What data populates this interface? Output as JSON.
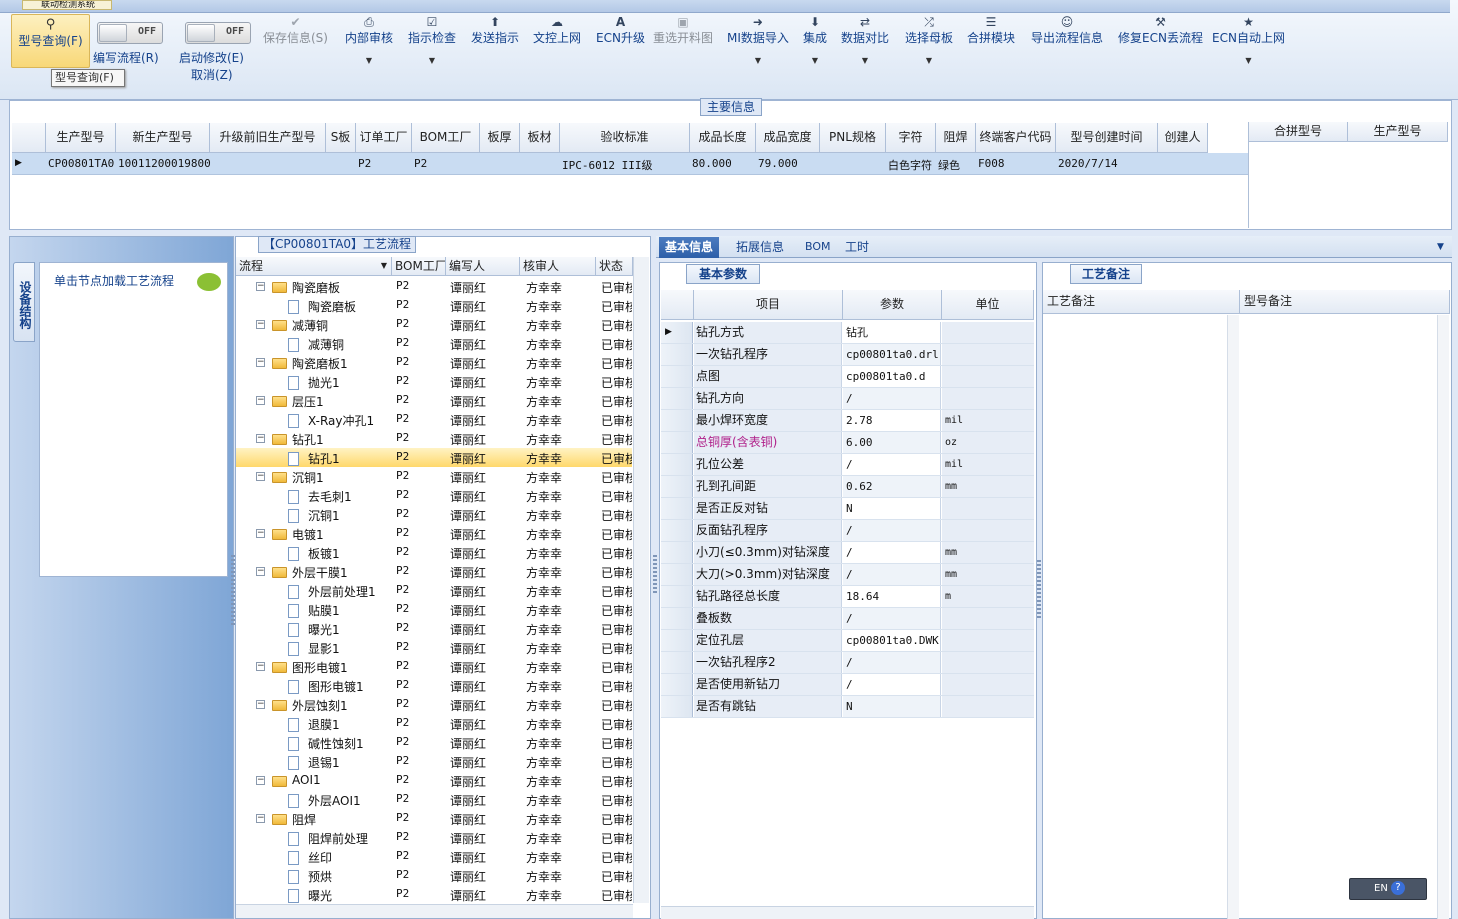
{
  "app": {
    "tab_title": "联动检测系统"
  },
  "toolbar": {
    "query": {
      "label": "型号查询(F)"
    },
    "toggle1": {
      "state": "OFF",
      "label": "编写流程(R)"
    },
    "toggle2": {
      "state": "OFF",
      "label": "启动修改(E)",
      "sublabel": "取消(Z)"
    },
    "buttons": [
      {
        "label": "保存信息(S)",
        "icon": "check-icon"
      },
      {
        "label": "内部审核",
        "icon": "printer-icon"
      },
      {
        "label": "指示检查",
        "icon": "checkbox-icon"
      },
      {
        "label": "发送指示",
        "icon": "upload-icon"
      },
      {
        "label": "文控上网",
        "icon": "cloud-upload-icon"
      },
      {
        "label": "ECN升级",
        "icon": "font-icon"
      },
      {
        "label": "重选开料图",
        "icon": "image-icon"
      },
      {
        "label": "MI数据导入",
        "icon": "import-icon"
      },
      {
        "label": "集成",
        "icon": "download-icon"
      },
      {
        "label": "数据对比",
        "icon": "compare-icon"
      },
      {
        "label": "选择母板",
        "icon": "shuffle-icon"
      },
      {
        "label": "合拼模块",
        "icon": "list-icon"
      },
      {
        "label": "导出流程信息",
        "icon": "smile-icon"
      },
      {
        "label": "修复ECN丢流程",
        "icon": "wrench-icon"
      },
      {
        "label": "ECN自动上网",
        "icon": "star-icon"
      }
    ],
    "tooltip": "型号查询(F)"
  },
  "main_info": {
    "title": "主要信息",
    "columns": [
      "生产型号",
      "新生产型号",
      "升级前旧生产型号",
      "S板",
      "订单工厂",
      "BOM工厂",
      "板厚",
      "板材",
      "验收标准",
      "成品长度",
      "成品宽度",
      "PNL规格",
      "字符",
      "阻焊",
      "终端客户代码",
      "型号创建时间",
      "创建人"
    ],
    "row": {
      "生产型号": "CP00801TA0",
      "新生产型号": "10011200019800",
      "订单工厂": "P2",
      "BOM工厂": "P2",
      "验收标准": "IPC-6012 III级",
      "成品长度": "80.000",
      "成品宽度": "79.000",
      "字符": "白色字符",
      "阻焊": "绿色",
      "终端客户代码": "F008",
      "型号创建时间": "2020/7/14"
    },
    "side_columns": [
      "合拼型号",
      "生产型号"
    ]
  },
  "left_panel": {
    "vtab": "设备结构",
    "hint": "单击节点加载工艺流程"
  },
  "tree": {
    "title": "【CP00801TA0】工艺流程",
    "columns": [
      "流程",
      "BOM工厂",
      "编写人",
      "核审人",
      "状态"
    ],
    "rows": [
      {
        "name": "陶瓷磨板",
        "level": 1,
        "folder": true,
        "bom": "P2",
        "writer": "谭丽红",
        "reviewer": "方幸幸",
        "status": "已审核"
      },
      {
        "name": "陶瓷磨板",
        "level": 2,
        "folder": false,
        "bom": "P2",
        "writer": "谭丽红",
        "reviewer": "方幸幸",
        "status": "已审核"
      },
      {
        "name": "减薄铜",
        "level": 1,
        "folder": true,
        "bom": "P2",
        "writer": "谭丽红",
        "reviewer": "方幸幸",
        "status": "已审核"
      },
      {
        "name": "减薄铜",
        "level": 2,
        "folder": false,
        "bom": "P2",
        "writer": "谭丽红",
        "reviewer": "方幸幸",
        "status": "已审核"
      },
      {
        "name": "陶瓷磨板1",
        "level": 1,
        "folder": true,
        "bom": "P2",
        "writer": "谭丽红",
        "reviewer": "方幸幸",
        "status": "已审核"
      },
      {
        "name": "抛光1",
        "level": 2,
        "folder": false,
        "bom": "P2",
        "writer": "谭丽红",
        "reviewer": "方幸幸",
        "status": "已审核"
      },
      {
        "name": "层压1",
        "level": 1,
        "folder": true,
        "bom": "P2",
        "writer": "谭丽红",
        "reviewer": "方幸幸",
        "status": "已审核"
      },
      {
        "name": "X-Ray冲孔1",
        "level": 2,
        "folder": false,
        "bom": "P2",
        "writer": "谭丽红",
        "reviewer": "方幸幸",
        "status": "已审核"
      },
      {
        "name": "钻孔1",
        "level": 1,
        "folder": true,
        "bom": "P2",
        "writer": "谭丽红",
        "reviewer": "方幸幸",
        "status": "已审核"
      },
      {
        "name": "钻孔1",
        "level": 2,
        "folder": false,
        "bom": "P2",
        "writer": "谭丽红",
        "reviewer": "方幸幸",
        "status": "已审核",
        "selected": true
      },
      {
        "name": "沉铜1",
        "level": 1,
        "folder": true,
        "bom": "P2",
        "writer": "谭丽红",
        "reviewer": "方幸幸",
        "status": "已审核"
      },
      {
        "name": "去毛刺1",
        "level": 2,
        "folder": false,
        "bom": "P2",
        "writer": "谭丽红",
        "reviewer": "方幸幸",
        "status": "已审核"
      },
      {
        "name": "沉铜1",
        "level": 2,
        "folder": false,
        "bom": "P2",
        "writer": "谭丽红",
        "reviewer": "方幸幸",
        "status": "已审核"
      },
      {
        "name": "电镀1",
        "level": 1,
        "folder": true,
        "bom": "P2",
        "writer": "谭丽红",
        "reviewer": "方幸幸",
        "status": "已审核"
      },
      {
        "name": "板镀1",
        "level": 2,
        "folder": false,
        "bom": "P2",
        "writer": "谭丽红",
        "reviewer": "方幸幸",
        "status": "已审核"
      },
      {
        "name": "外层干膜1",
        "level": 1,
        "folder": true,
        "bom": "P2",
        "writer": "谭丽红",
        "reviewer": "方幸幸",
        "status": "已审核"
      },
      {
        "name": "外层前处理1",
        "level": 2,
        "folder": false,
        "bom": "P2",
        "writer": "谭丽红",
        "reviewer": "方幸幸",
        "status": "已审核"
      },
      {
        "name": "贴膜1",
        "level": 2,
        "folder": false,
        "bom": "P2",
        "writer": "谭丽红",
        "reviewer": "方幸幸",
        "status": "已审核"
      },
      {
        "name": "曝光1",
        "level": 2,
        "folder": false,
        "bom": "P2",
        "writer": "谭丽红",
        "reviewer": "方幸幸",
        "status": "已审核"
      },
      {
        "name": "显影1",
        "level": 2,
        "folder": false,
        "bom": "P2",
        "writer": "谭丽红",
        "reviewer": "方幸幸",
        "status": "已审核"
      },
      {
        "name": "图形电镀1",
        "level": 1,
        "folder": true,
        "bom": "P2",
        "writer": "谭丽红",
        "reviewer": "方幸幸",
        "status": "已审核"
      },
      {
        "name": "图形电镀1",
        "level": 2,
        "folder": false,
        "bom": "P2",
        "writer": "谭丽红",
        "reviewer": "方幸幸",
        "status": "已审核"
      },
      {
        "name": "外层蚀刻1",
        "level": 1,
        "folder": true,
        "bom": "P2",
        "writer": "谭丽红",
        "reviewer": "方幸幸",
        "status": "已审核"
      },
      {
        "name": "退膜1",
        "level": 2,
        "folder": false,
        "bom": "P2",
        "writer": "谭丽红",
        "reviewer": "方幸幸",
        "status": "已审核"
      },
      {
        "name": "碱性蚀刻1",
        "level": 2,
        "folder": false,
        "bom": "P2",
        "writer": "谭丽红",
        "reviewer": "方幸幸",
        "status": "已审核"
      },
      {
        "name": "退锡1",
        "level": 2,
        "folder": false,
        "bom": "P2",
        "writer": "谭丽红",
        "reviewer": "方幸幸",
        "status": "已审核"
      },
      {
        "name": "AOI1",
        "level": 1,
        "folder": true,
        "bom": "P2",
        "writer": "谭丽红",
        "reviewer": "方幸幸",
        "status": "已审核"
      },
      {
        "name": "外层AOI1",
        "level": 2,
        "folder": false,
        "bom": "P2",
        "writer": "谭丽红",
        "reviewer": "方幸幸",
        "status": "已审核"
      },
      {
        "name": "阻焊",
        "level": 1,
        "folder": true,
        "bom": "P2",
        "writer": "谭丽红",
        "reviewer": "方幸幸",
        "status": "已审核"
      },
      {
        "name": "阻焊前处理",
        "level": 2,
        "folder": false,
        "bom": "P2",
        "writer": "谭丽红",
        "reviewer": "方幸幸",
        "status": "已审核"
      },
      {
        "name": "丝印",
        "level": 2,
        "folder": false,
        "bom": "P2",
        "writer": "谭丽红",
        "reviewer": "方幸幸",
        "status": "已审核"
      },
      {
        "name": "预烘",
        "level": 2,
        "folder": false,
        "bom": "P2",
        "writer": "谭丽红",
        "reviewer": "方幸幸",
        "status": "已审核"
      },
      {
        "name": "曝光",
        "level": 2,
        "folder": false,
        "bom": "P2",
        "writer": "谭丽红",
        "reviewer": "方幸幸",
        "status": "已审核"
      }
    ]
  },
  "right_tabs": [
    "基本信息",
    "拓展信息",
    "BOM",
    "工时"
  ],
  "basic": {
    "title": "基本参数",
    "columns": [
      "项目",
      "参数",
      "单位"
    ],
    "rows": [
      {
        "item": "钻孔方式",
        "value": "钻孔",
        "unit": ""
      },
      {
        "item": "一次钻孔程序",
        "value": "cp00801ta0.drl",
        "unit": ""
      },
      {
        "item": "点图",
        "value": "cp00801ta0.d",
        "unit": ""
      },
      {
        "item": "钻孔方向",
        "value": "/",
        "unit": ""
      },
      {
        "item": "最小焊环宽度",
        "value": "2.78",
        "unit": "mil"
      },
      {
        "item": "总铜厚(含表铜)",
        "value": "6.00",
        "unit": "oz",
        "highlight": true
      },
      {
        "item": "孔位公差",
        "value": "/",
        "unit": "mil"
      },
      {
        "item": "孔到孔间距",
        "value": "0.62",
        "unit": "mm"
      },
      {
        "item": "是否正反对钻",
        "value": "N",
        "unit": ""
      },
      {
        "item": "反面钻孔程序",
        "value": "/",
        "unit": ""
      },
      {
        "item": "小刀(≤0.3mm)对钻深度",
        "value": "/",
        "unit": "mm"
      },
      {
        "item": "大刀(>0.3mm)对钻深度",
        "value": "/",
        "unit": "mm"
      },
      {
        "item": "钻孔路径总长度",
        "value": "18.64",
        "unit": "m"
      },
      {
        "item": "叠板数",
        "value": "/",
        "unit": ""
      },
      {
        "item": "定位孔层",
        "value": "cp00801ta0.DWK",
        "unit": ""
      },
      {
        "item": "一次钻孔程序2",
        "value": "/",
        "unit": ""
      },
      {
        "item": "是否使用新钻刀",
        "value": "/",
        "unit": ""
      },
      {
        "item": "是否有跳钻",
        "value": "N",
        "unit": ""
      }
    ]
  },
  "notes": {
    "title": "工艺备注",
    "columns": [
      "工艺备注",
      "型号备注"
    ]
  },
  "ime": {
    "label": "EN",
    "help": "?"
  },
  "colors": {
    "accent": "#15428b",
    "selection": "#ffd86b",
    "highlight_text": "#b0208a"
  }
}
